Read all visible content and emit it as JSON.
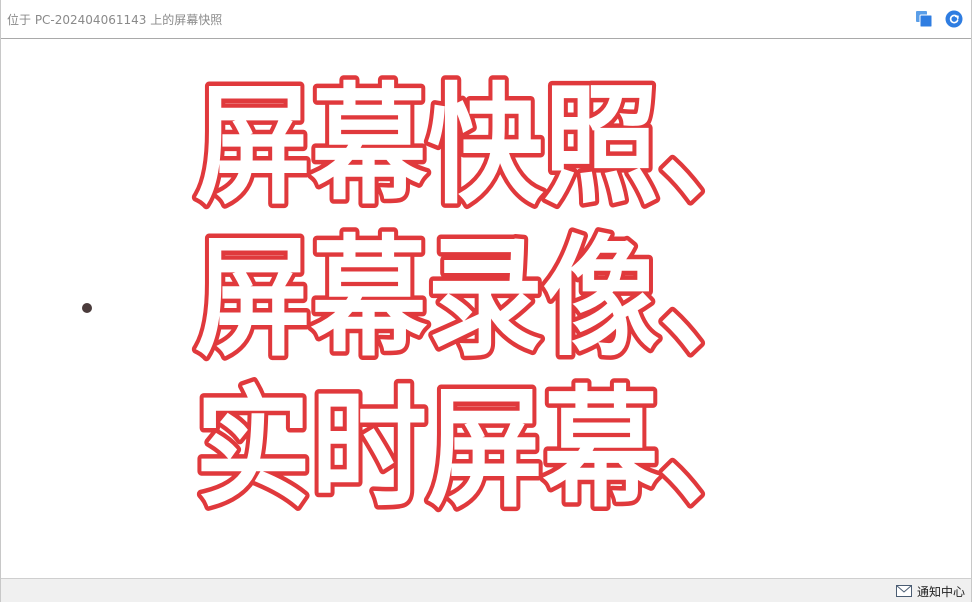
{
  "window": {
    "title": "位于 PC-202404061143 上的屏幕快照"
  },
  "toolbar": {
    "windows_icon": "windows-icon",
    "refresh_icon": "refresh-icon",
    "accent": "#2f7de1"
  },
  "content": {
    "lines": [
      "屏幕快照、",
      "屏幕录像、",
      "实时屏幕、"
    ],
    "text_fill": "#ffffff",
    "text_stroke": "#e0393c",
    "cursor_color": "#4a3b3b"
  },
  "statusbar": {
    "notify_label": "通知中心",
    "notify_icon": "mail-icon"
  }
}
